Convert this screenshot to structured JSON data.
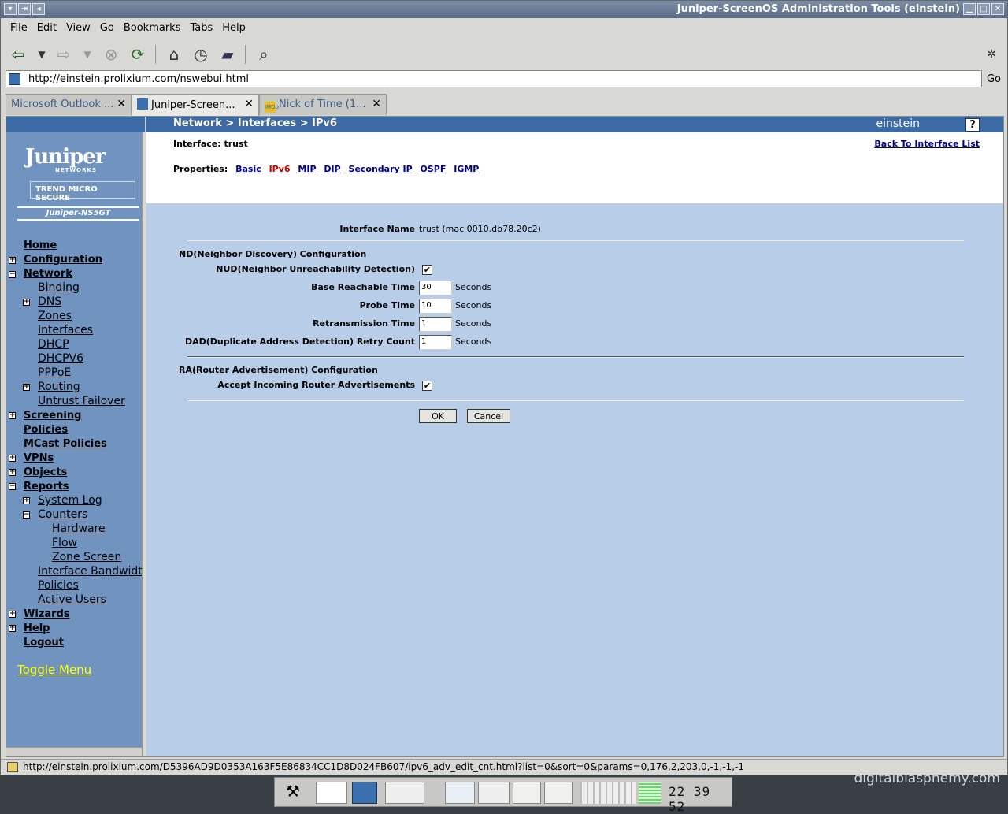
{
  "window": {
    "title": "Juniper-ScreenOS Administration Tools (einstein)"
  },
  "menu": [
    "File",
    "Edit",
    "View",
    "Go",
    "Bookmarks",
    "Tabs",
    "Help"
  ],
  "address": {
    "url": "http://einstein.prolixium.com/nswebui.html",
    "go": "Go"
  },
  "tabs": [
    {
      "label": "Microsoft Outlook ..."
    },
    {
      "label": "Juniper-Screen..."
    },
    {
      "label": "Nick of Time (1..."
    }
  ],
  "page": {
    "breadcrumb": "Network > Interfaces > IPv6",
    "host": "einstein",
    "help": "?",
    "interface_label": "Interface: trust",
    "back_link": "Back To Interface List",
    "properties_label": "Properties:",
    "properties": [
      "Basic",
      "IPv6",
      "MIP",
      "DIP",
      "Secondary IP",
      "OSPF",
      "IGMP"
    ]
  },
  "sidebar": {
    "logo_text": "Juniper",
    "logo_sub": "NETWORKS",
    "trend": "TREND MICRO  SECURE",
    "device": "Juniper-NS5GT",
    "items": [
      {
        "label": "Home"
      },
      {
        "label": "Configuration"
      },
      {
        "label": "Network"
      },
      {
        "label": "Binding"
      },
      {
        "label": "DNS"
      },
      {
        "label": "Zones"
      },
      {
        "label": "Interfaces"
      },
      {
        "label": "DHCP"
      },
      {
        "label": "DHCPV6"
      },
      {
        "label": "PPPoE"
      },
      {
        "label": "Routing"
      },
      {
        "label": "Untrust Failover"
      },
      {
        "label": "Screening"
      },
      {
        "label": "Policies"
      },
      {
        "label": "MCast Policies"
      },
      {
        "label": "VPNs"
      },
      {
        "label": "Objects"
      },
      {
        "label": "Reports"
      },
      {
        "label": "System Log"
      },
      {
        "label": "Counters"
      },
      {
        "label": "Hardware"
      },
      {
        "label": "Flow"
      },
      {
        "label": "Zone Screen"
      },
      {
        "label": "Interface Bandwidth"
      },
      {
        "label": "Policies"
      },
      {
        "label": "Active Users"
      },
      {
        "label": "Wizards"
      },
      {
        "label": "Help"
      },
      {
        "label": "Logout"
      }
    ],
    "toggle": "Toggle Menu"
  },
  "form": {
    "iface_name_label": "Interface Name",
    "iface_name_value": "trust (mac 0010.db78.20c2)",
    "nd_section": "ND(Neighbor Discovery) Configuration",
    "nud_label": "NUD(Neighbor Unreachability Detection)",
    "nud_checked": "✔",
    "base_label": "Base Reachable Time",
    "base_value": "30",
    "probe_label": "Probe Time",
    "probe_value": "10",
    "retrans_label": "Retransmission Time",
    "retrans_value": "1",
    "dad_label": "DAD(Duplicate Address Detection) Retry Count",
    "dad_value": "1",
    "seconds": "Seconds",
    "ra_section": "RA(Router Advertisement) Configuration",
    "ra_label": "Accept Incoming Router Advertisements",
    "ra_checked": "✔",
    "ok": "OK",
    "cancel": "Cancel"
  },
  "status": {
    "url": "http://einstein.prolixium.com/D5396AD9D0353A163F5E86834CC1D8D024FB607/ipv6_adv_edit_cnt.html?list=0&sort=0&params=0,176,2,203,0,-1,-1,-1"
  },
  "taskbar": {
    "clock": "22 39 52"
  },
  "desktop": {
    "brand": "digitalblasphemy.com"
  }
}
